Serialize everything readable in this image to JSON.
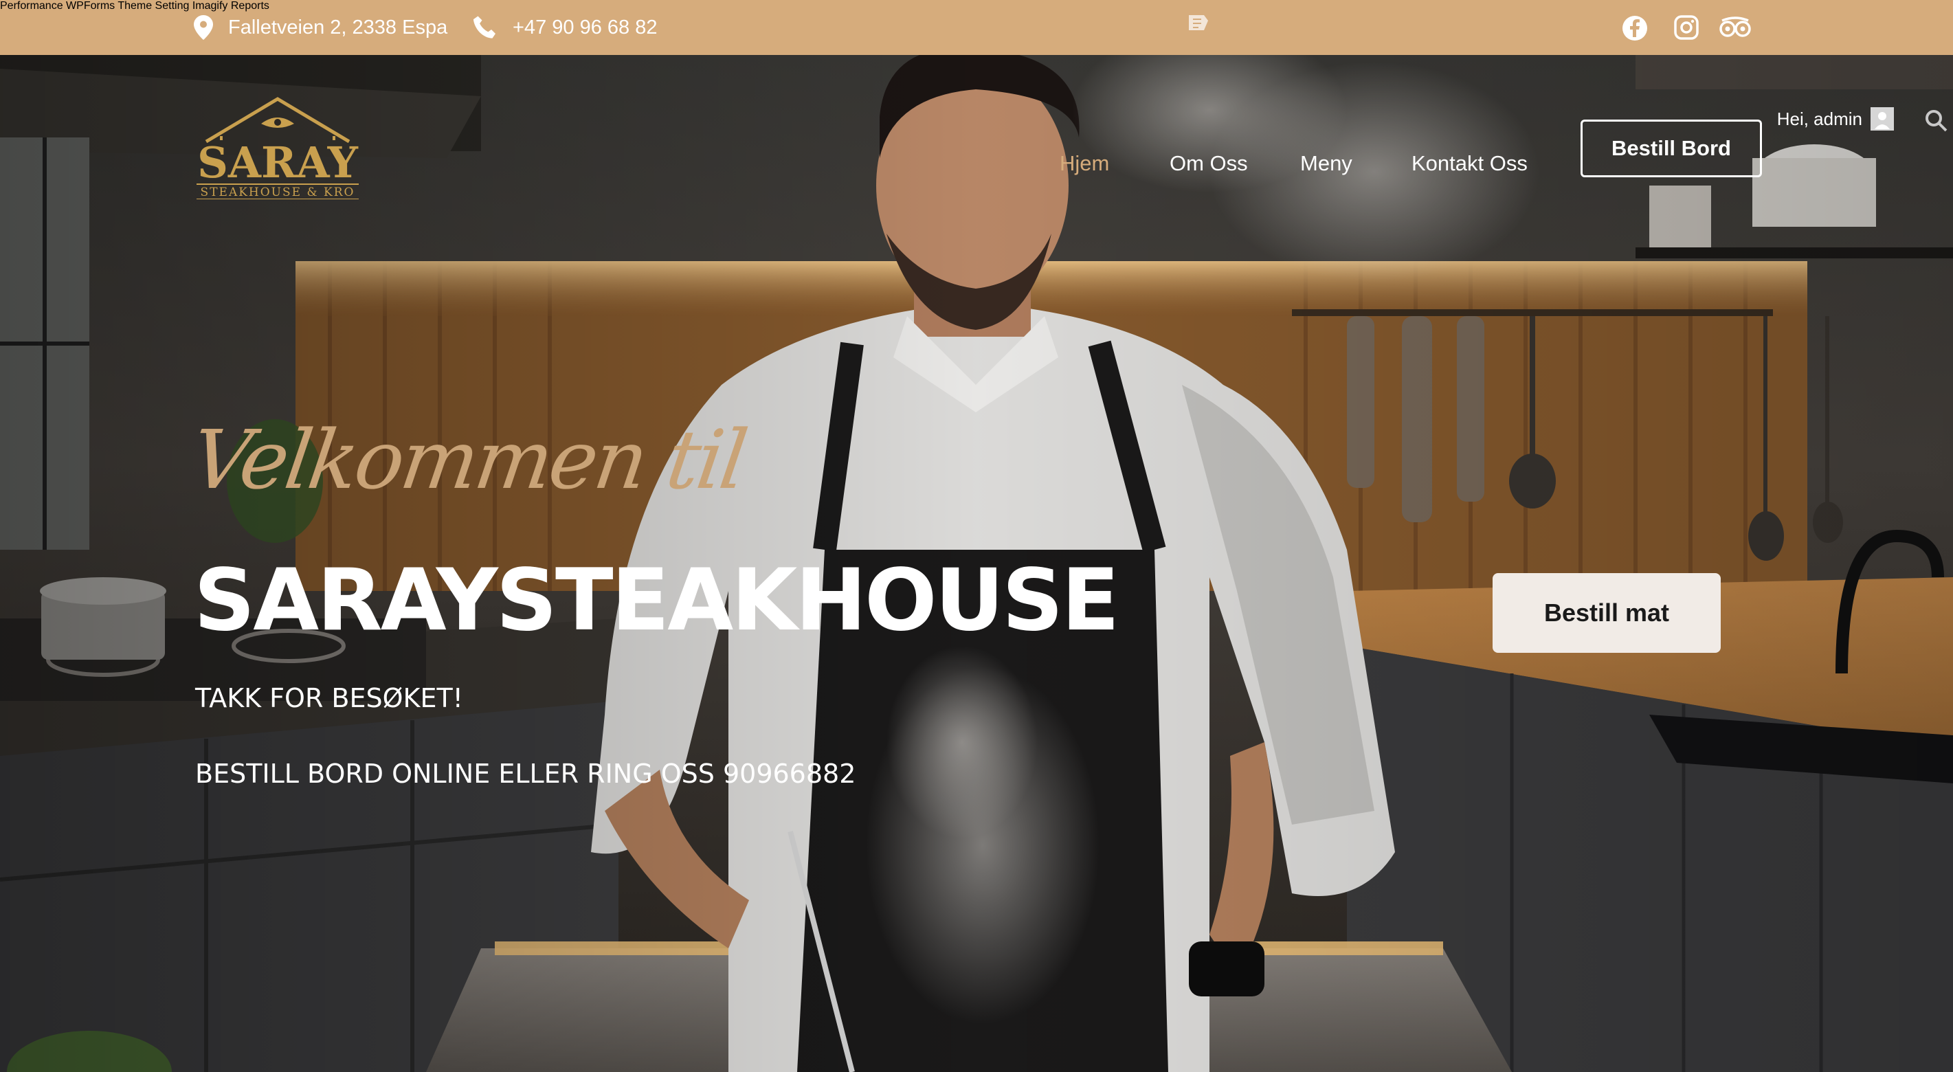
{
  "topbar": {
    "address": "Falletveien 2, 2338 Espa",
    "phone": "+47 90 96 68 82"
  },
  "admin_menu": {
    "items": [
      "Performance",
      "WPForms",
      "Theme Setting",
      "Imagify",
      "Reports"
    ]
  },
  "user": {
    "greeting": "Hei, admin"
  },
  "logo": {
    "name": "SARAY",
    "tagline": "STEAKHOUSE & KRO"
  },
  "nav": {
    "items": [
      "Hjem",
      "Om Oss",
      "Meny",
      "Kontakt Oss"
    ],
    "active": "Hjem",
    "cta": "Bestill Bord"
  },
  "hero": {
    "script": "Velkommen til",
    "title": "SARAYSTEAKHOUSE",
    "line1": "TAKK FOR BESØKET!",
    "line2": "BESTILL BORD ONLINE ELLER RING OSS 90966882",
    "order_button": "Bestill mat"
  },
  "colors": {
    "accent": "#d6ac7c",
    "text": "#ffffff",
    "button_bg": "#f1ebe6"
  }
}
